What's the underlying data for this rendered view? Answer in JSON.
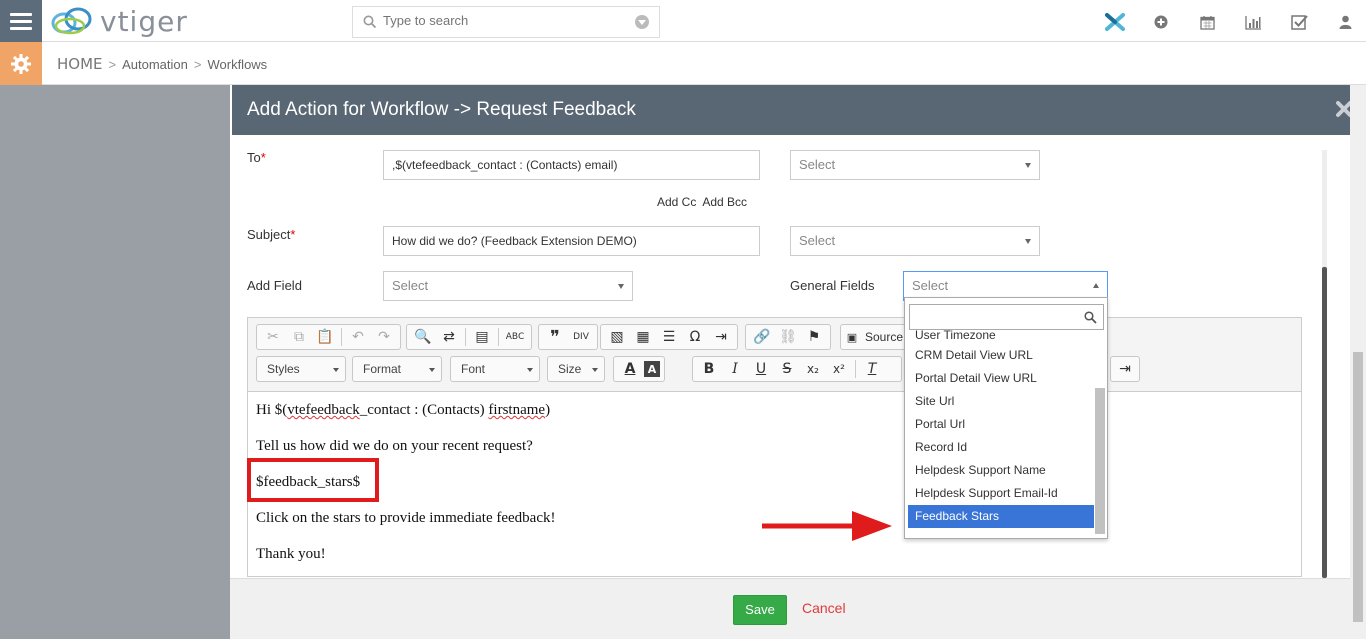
{
  "app": {
    "logo_text": "vtiger",
    "brand_colors": {
      "header": "#596673",
      "settings_accent": "#f0a466",
      "save": "#35aa47",
      "cancel": "#e03a3a",
      "highlight": "#e01b1b",
      "selected": "#3875d7"
    }
  },
  "search": {
    "placeholder": "Type to search"
  },
  "top_icons": [
    "vtiger-x-icon",
    "plus-circle-icon",
    "calendar-icon",
    "bar-chart-icon",
    "checkbox-icon",
    "user-icon"
  ],
  "breadcrumb": {
    "home": "HOME",
    "items": [
      "Automation",
      "Workflows"
    ],
    "separator": ">"
  },
  "modal": {
    "title": "Add Action for Workflow -> Request Feedback",
    "to_label": "To",
    "to_value": ",$(vtefeedback_contact : (Contacts) email)",
    "to_select": "Select",
    "add_cc": "Add Cc",
    "add_bcc": "Add Bcc",
    "subject_label": "Subject",
    "subject_value": "How did we do? (Feedback Extension DEMO)",
    "subject_select": "Select",
    "add_field_label": "Add Field",
    "add_field_select": "Select",
    "general_fields_label": "General Fields",
    "general_fields_select": "Select",
    "required_mark": "*"
  },
  "toolbar": {
    "source_label": "Source",
    "styles": "Styles",
    "format": "Format",
    "font": "Font",
    "size": "Size"
  },
  "editor": {
    "line1_prefix": "Hi $(",
    "line1_word1": "vtefeedback",
    "line1_mid": "_contact : (Contacts) ",
    "line1_word2": "firstname",
    "line1_suffix": ")",
    "line2": "Tell us how did we do on your recent request?",
    "line3": "$feedback_stars$",
    "line4": "Click on the stars to provide immediate feedback!",
    "line5": "Thank you!"
  },
  "dropdown": {
    "items": [
      "User Timezone",
      "CRM Detail View URL",
      "Portal Detail View URL",
      "Site Url",
      "Portal Url",
      "Record Id",
      "Helpdesk Support Name",
      "Helpdesk Support Email-Id",
      "Feedback Stars"
    ],
    "selected": "Feedback Stars"
  },
  "footer": {
    "save": "Save",
    "cancel": "Cancel"
  }
}
